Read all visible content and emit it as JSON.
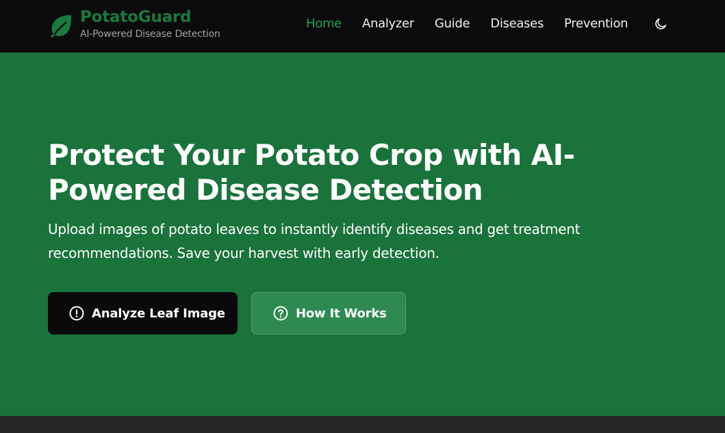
{
  "brand": {
    "name": "PotatoGuard",
    "tagline": "AI-Powered Disease Detection",
    "logo_icon": "leaf-icon"
  },
  "nav": {
    "items": [
      {
        "label": "Home",
        "active": true
      },
      {
        "label": "Analyzer",
        "active": false
      },
      {
        "label": "Guide",
        "active": false
      },
      {
        "label": "Diseases",
        "active": false
      },
      {
        "label": "Prevention",
        "active": false
      }
    ],
    "theme_toggle_icon": "moon-icon"
  },
  "hero": {
    "title": "Protect Your Potato Crop with AI-Powered Disease Detection",
    "subtitle": "Upload images of potato leaves to instantly identify diseases and get treatment recommendations. Save your harvest with early detection.",
    "primary_button": {
      "label": "Analyze Leaf Image",
      "icon": "alert-circle-icon"
    },
    "secondary_button": {
      "label": "How It Works",
      "icon": "help-circle-icon"
    }
  },
  "colors": {
    "navbar_bg": "#0b0b0d",
    "brand_green": "#1b7a3c",
    "active_nav": "#22a152",
    "hero_bg": "#1a733b",
    "primary_button_bg": "#0a0a0c",
    "secondary_button_bg": "#2f8a51",
    "footer_bg": "#262628"
  }
}
